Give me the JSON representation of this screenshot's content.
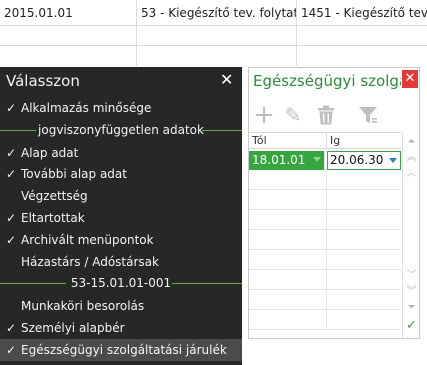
{
  "background_table": {
    "rows": [
      {
        "cells": [
          "2015.01.01",
          "53 - Kiegészítő tev. folytató",
          "1451 - Kiegészítő tev."
        ]
      },
      {
        "cells": [
          "",
          "",
          ""
        ]
      },
      {
        "cells": [
          "",
          "",
          ""
        ]
      }
    ]
  },
  "menu": {
    "title": "Válasszon",
    "close_glyph": "✕",
    "check_glyph": "✓",
    "items": [
      {
        "label": "Alkalmazás minősége",
        "checked": true,
        "type": "item"
      },
      {
        "label": "jogviszonyfüggetlen adatok",
        "type": "separator"
      },
      {
        "label": "Alap adat",
        "checked": true,
        "type": "item"
      },
      {
        "label": "További alap adat",
        "checked": true,
        "type": "item"
      },
      {
        "label": "Végzettség",
        "checked": false,
        "type": "item"
      },
      {
        "label": "Eltartottak",
        "checked": true,
        "type": "item"
      },
      {
        "label": "Archivált menüpontok",
        "checked": true,
        "type": "item"
      },
      {
        "label": "Házastárs / Adóstársak",
        "checked": false,
        "type": "item"
      },
      {
        "label": "53-15.01.01-001",
        "type": "separator"
      },
      {
        "label": "Munkaköri besorolás",
        "checked": false,
        "type": "item"
      },
      {
        "label": "Személyi alapbér",
        "checked": true,
        "type": "item"
      },
      {
        "label": "Egészségügyi szolgáltatási járulék",
        "checked": true,
        "type": "item",
        "selected": true
      }
    ]
  },
  "panel": {
    "title": "Egészségügyi szolgá",
    "close_glyph": "✕",
    "toolbar": {
      "add_glyph": "+",
      "edit_glyph": "✎",
      "delete_glyph": "🗑",
      "filter_glyph": "▼"
    },
    "grid": {
      "columns": [
        "Tól",
        "Ig"
      ],
      "rows": [
        {
          "from": "18.01.01",
          "to": "20.06.30"
        }
      ]
    },
    "scroll": {
      "top_glyph": "⏶",
      "page_up_glyph": "︽",
      "up_glyph": "︿",
      "down_glyph": "﹀",
      "page_down_glyph": "︾",
      "bottom_glyph": "⏷",
      "ok_glyph": "✓"
    }
  },
  "colors": {
    "menu_bg": "#272727",
    "accent_green": "#37a640",
    "close_red": "#e23a3a",
    "title_green": "#2e8b3a"
  }
}
